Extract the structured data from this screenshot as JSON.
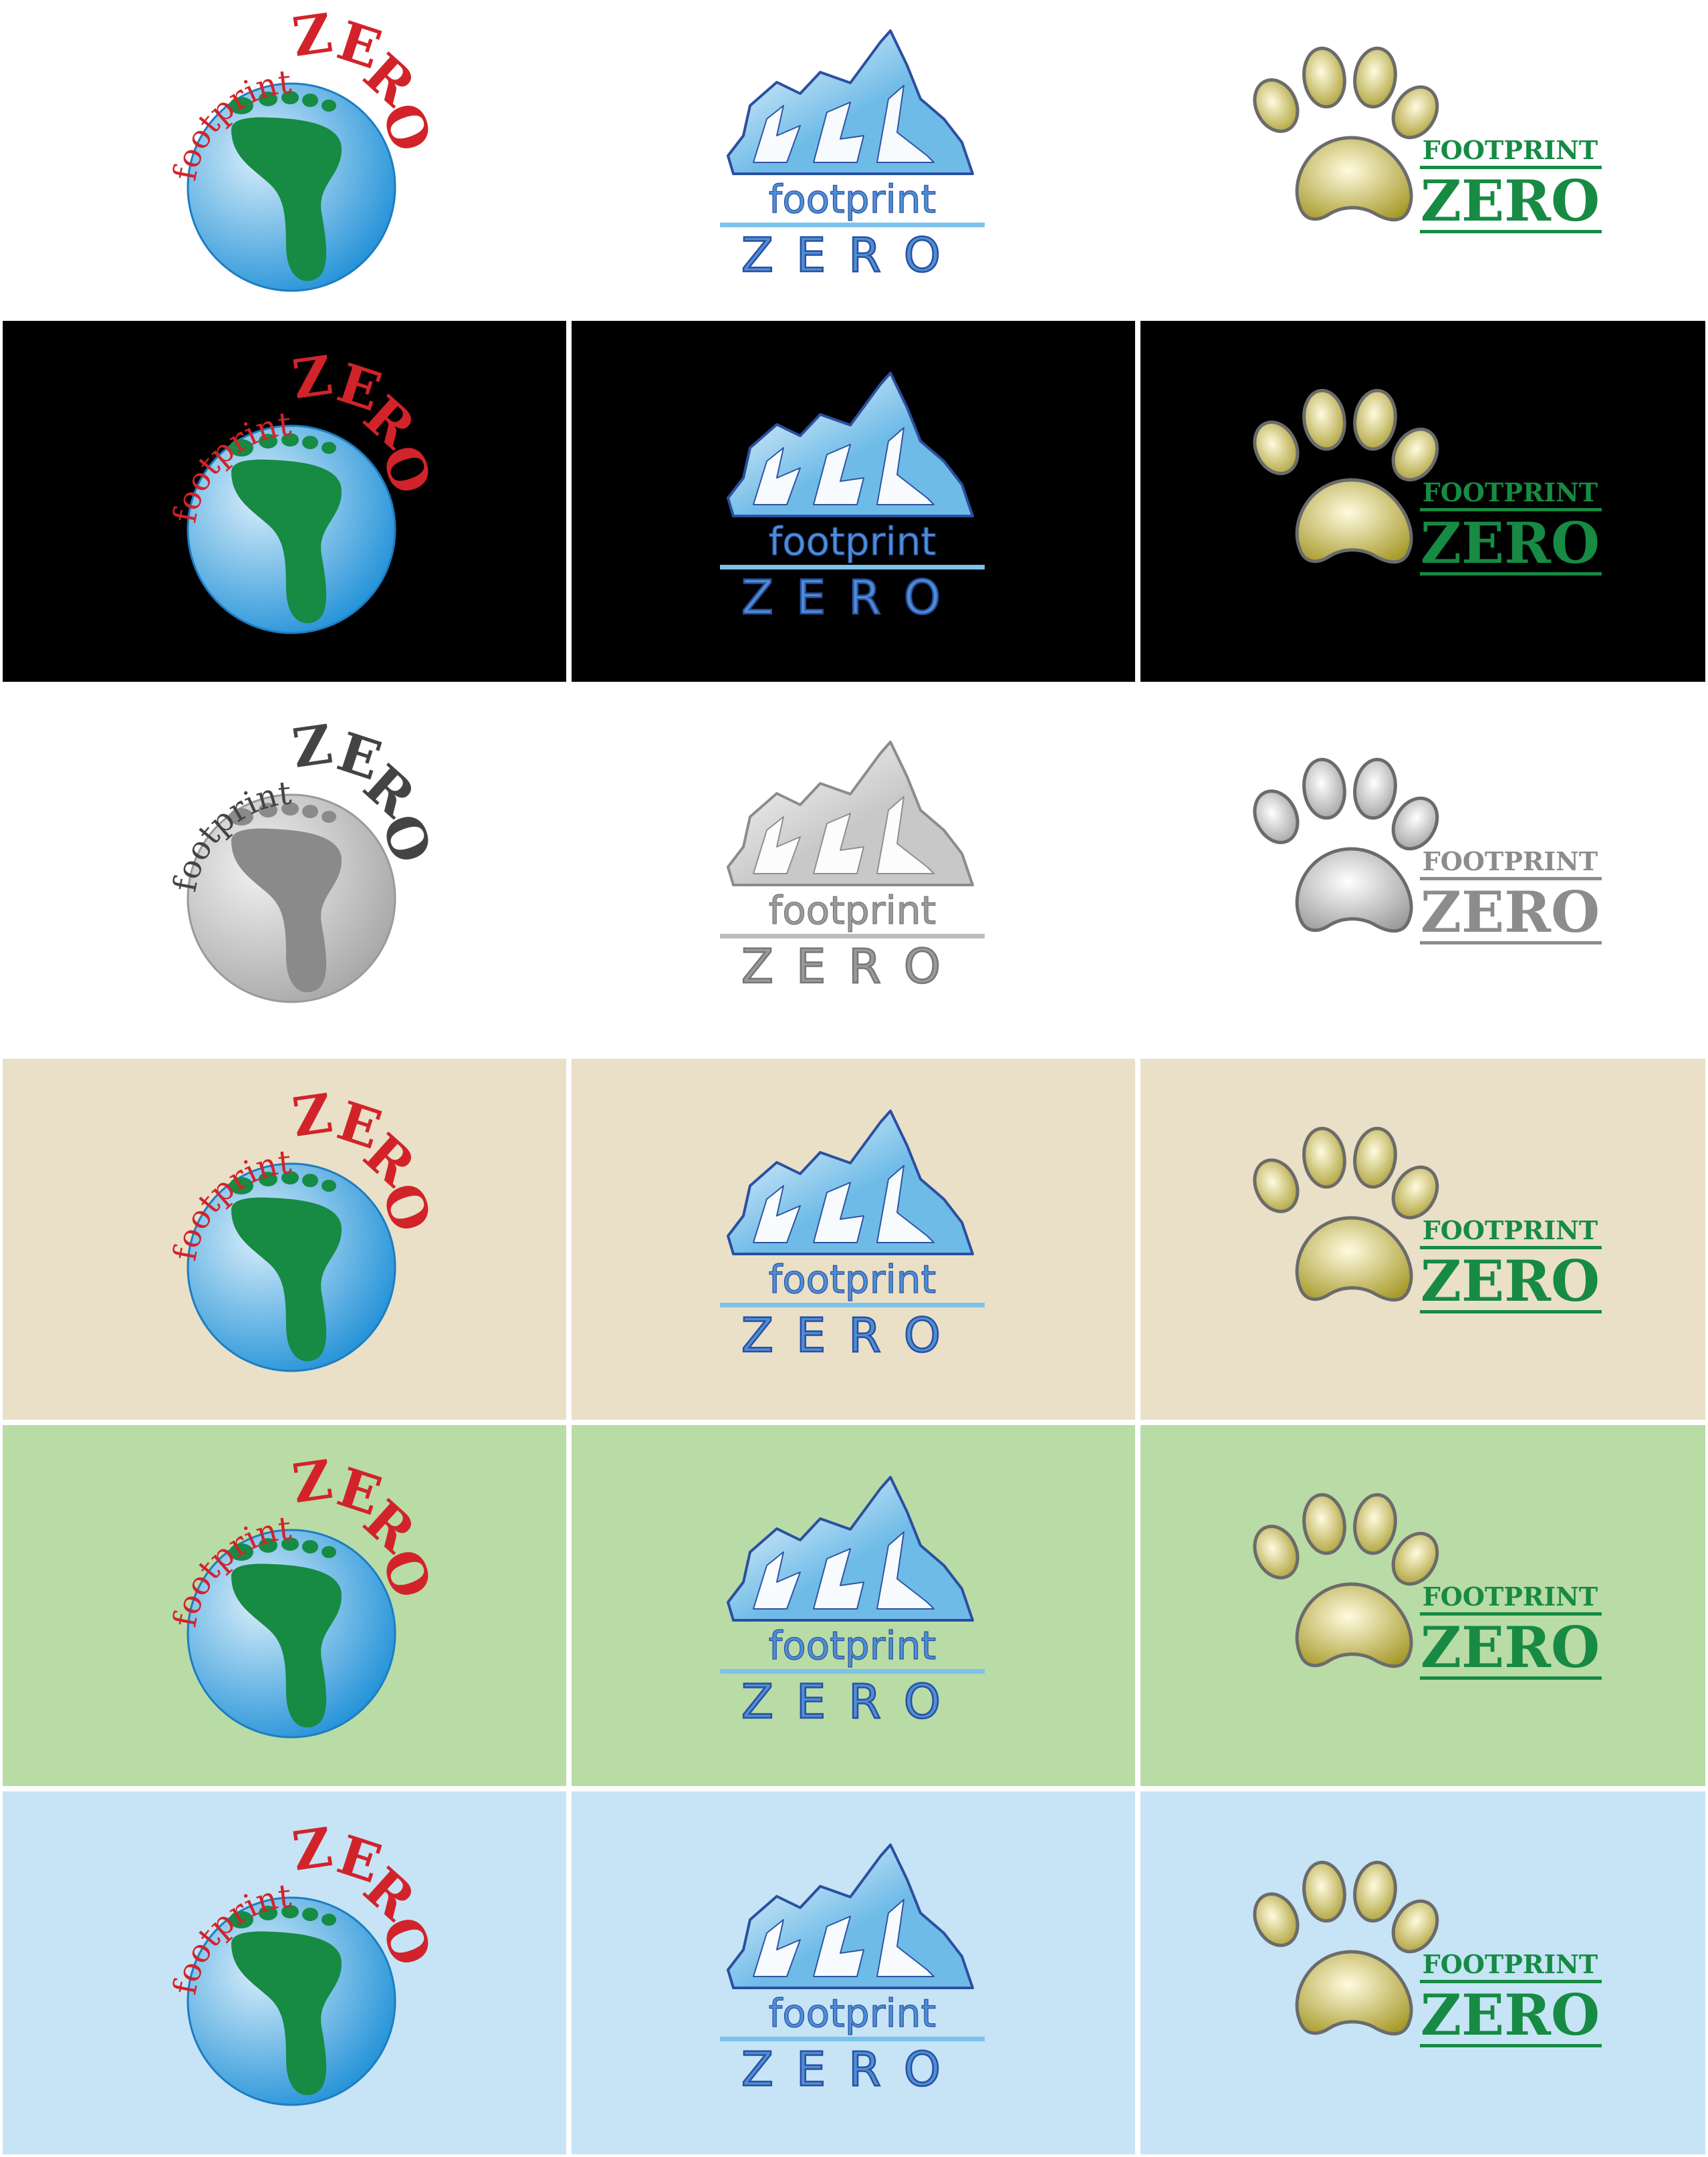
{
  "brand": {
    "word_small": "footprint",
    "word_big": "ZERO",
    "paw_word_small": "FOOTPRINT",
    "paw_word_big": "ZERO"
  },
  "rows": [
    {
      "background": "#ffffff",
      "variant": "color"
    },
    {
      "background": "#000000",
      "variant": "color"
    },
    {
      "background": "#ffffff",
      "variant": "grayscale"
    },
    {
      "background": "#e9e0c7",
      "variant": "color"
    },
    {
      "background": "#b9dba6",
      "variant": "color"
    },
    {
      "background": "#c6e4f6",
      "variant": "color"
    }
  ],
  "palettes": {
    "color": {
      "foot_text": "#d2232a",
      "globe_light": "#d9eefa",
      "globe_dark": "#1b8ed6",
      "globe_stroke": "#1d7dc2",
      "foot": "#178a43",
      "ice_light": "#ffffff",
      "ice_blue": "#6fbbe8",
      "ice_stroke": "#2b4fa0",
      "ice_text": "#4c8fd6",
      "ice_text_stroke": "#2b4fa0",
      "ice_line": "#7cc3ec",
      "paw_light": "#fffbe0",
      "paw_dark": "#a79a2a",
      "paw_stroke": "#6b6b6b",
      "paw_text": "#178a43"
    },
    "grayscale": {
      "foot_text": "#444444",
      "globe_light": "#f2f2f2",
      "globe_dark": "#a4a4a4",
      "globe_stroke": "#9a9a9a",
      "foot": "#8a8a8a",
      "ice_light": "#ffffff",
      "ice_blue": "#c8c8c8",
      "ice_stroke": "#8c8c8c",
      "ice_text": "#9a9a9a",
      "ice_text_stroke": "#777777",
      "ice_line": "#bdbdbd",
      "paw_light": "#ffffff",
      "paw_dark": "#9b9b9b",
      "paw_stroke": "#6b6b6b",
      "paw_text": "#8c8c8c"
    }
  },
  "icons": [
    "footprint-globe-icon",
    "iceberg-icon",
    "paw-print-icon"
  ]
}
